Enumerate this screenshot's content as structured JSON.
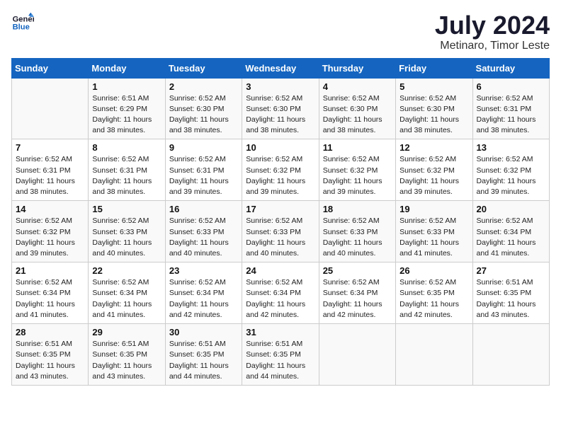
{
  "header": {
    "logo_general": "General",
    "logo_blue": "Blue",
    "month": "July 2024",
    "location": "Metinaro, Timor Leste"
  },
  "days_of_week": [
    "Sunday",
    "Monday",
    "Tuesday",
    "Wednesday",
    "Thursday",
    "Friday",
    "Saturday"
  ],
  "weeks": [
    [
      {
        "day": "",
        "info": ""
      },
      {
        "day": "1",
        "info": "Sunrise: 6:51 AM\nSunset: 6:29 PM\nDaylight: 11 hours and 38 minutes."
      },
      {
        "day": "2",
        "info": "Sunrise: 6:52 AM\nSunset: 6:30 PM\nDaylight: 11 hours and 38 minutes."
      },
      {
        "day": "3",
        "info": "Sunrise: 6:52 AM\nSunset: 6:30 PM\nDaylight: 11 hours and 38 minutes."
      },
      {
        "day": "4",
        "info": "Sunrise: 6:52 AM\nSunset: 6:30 PM\nDaylight: 11 hours and 38 minutes."
      },
      {
        "day": "5",
        "info": "Sunrise: 6:52 AM\nSunset: 6:30 PM\nDaylight: 11 hours and 38 minutes."
      },
      {
        "day": "6",
        "info": "Sunrise: 6:52 AM\nSunset: 6:31 PM\nDaylight: 11 hours and 38 minutes."
      }
    ],
    [
      {
        "day": "7",
        "info": "Sunrise: 6:52 AM\nSunset: 6:31 PM\nDaylight: 11 hours and 38 minutes."
      },
      {
        "day": "8",
        "info": "Sunrise: 6:52 AM\nSunset: 6:31 PM\nDaylight: 11 hours and 38 minutes."
      },
      {
        "day": "9",
        "info": "Sunrise: 6:52 AM\nSunset: 6:31 PM\nDaylight: 11 hours and 39 minutes."
      },
      {
        "day": "10",
        "info": "Sunrise: 6:52 AM\nSunset: 6:32 PM\nDaylight: 11 hours and 39 minutes."
      },
      {
        "day": "11",
        "info": "Sunrise: 6:52 AM\nSunset: 6:32 PM\nDaylight: 11 hours and 39 minutes."
      },
      {
        "day": "12",
        "info": "Sunrise: 6:52 AM\nSunset: 6:32 PM\nDaylight: 11 hours and 39 minutes."
      },
      {
        "day": "13",
        "info": "Sunrise: 6:52 AM\nSunset: 6:32 PM\nDaylight: 11 hours and 39 minutes."
      }
    ],
    [
      {
        "day": "14",
        "info": "Sunrise: 6:52 AM\nSunset: 6:32 PM\nDaylight: 11 hours and 39 minutes."
      },
      {
        "day": "15",
        "info": "Sunrise: 6:52 AM\nSunset: 6:33 PM\nDaylight: 11 hours and 40 minutes."
      },
      {
        "day": "16",
        "info": "Sunrise: 6:52 AM\nSunset: 6:33 PM\nDaylight: 11 hours and 40 minutes."
      },
      {
        "day": "17",
        "info": "Sunrise: 6:52 AM\nSunset: 6:33 PM\nDaylight: 11 hours and 40 minutes."
      },
      {
        "day": "18",
        "info": "Sunrise: 6:52 AM\nSunset: 6:33 PM\nDaylight: 11 hours and 40 minutes."
      },
      {
        "day": "19",
        "info": "Sunrise: 6:52 AM\nSunset: 6:33 PM\nDaylight: 11 hours and 41 minutes."
      },
      {
        "day": "20",
        "info": "Sunrise: 6:52 AM\nSunset: 6:34 PM\nDaylight: 11 hours and 41 minutes."
      }
    ],
    [
      {
        "day": "21",
        "info": "Sunrise: 6:52 AM\nSunset: 6:34 PM\nDaylight: 11 hours and 41 minutes."
      },
      {
        "day": "22",
        "info": "Sunrise: 6:52 AM\nSunset: 6:34 PM\nDaylight: 11 hours and 41 minutes."
      },
      {
        "day": "23",
        "info": "Sunrise: 6:52 AM\nSunset: 6:34 PM\nDaylight: 11 hours and 42 minutes."
      },
      {
        "day": "24",
        "info": "Sunrise: 6:52 AM\nSunset: 6:34 PM\nDaylight: 11 hours and 42 minutes."
      },
      {
        "day": "25",
        "info": "Sunrise: 6:52 AM\nSunset: 6:34 PM\nDaylight: 11 hours and 42 minutes."
      },
      {
        "day": "26",
        "info": "Sunrise: 6:52 AM\nSunset: 6:35 PM\nDaylight: 11 hours and 42 minutes."
      },
      {
        "day": "27",
        "info": "Sunrise: 6:51 AM\nSunset: 6:35 PM\nDaylight: 11 hours and 43 minutes."
      }
    ],
    [
      {
        "day": "28",
        "info": "Sunrise: 6:51 AM\nSunset: 6:35 PM\nDaylight: 11 hours and 43 minutes."
      },
      {
        "day": "29",
        "info": "Sunrise: 6:51 AM\nSunset: 6:35 PM\nDaylight: 11 hours and 43 minutes."
      },
      {
        "day": "30",
        "info": "Sunrise: 6:51 AM\nSunset: 6:35 PM\nDaylight: 11 hours and 44 minutes."
      },
      {
        "day": "31",
        "info": "Sunrise: 6:51 AM\nSunset: 6:35 PM\nDaylight: 11 hours and 44 minutes."
      },
      {
        "day": "",
        "info": ""
      },
      {
        "day": "",
        "info": ""
      },
      {
        "day": "",
        "info": ""
      }
    ]
  ]
}
